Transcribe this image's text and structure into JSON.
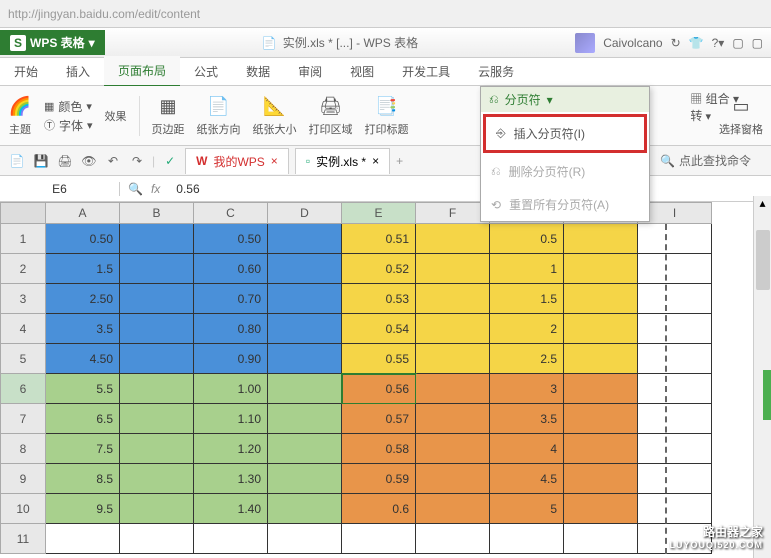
{
  "browser": {
    "url": "http://jingyan.baidu.com/edit/content"
  },
  "app": {
    "name": "WPS 表格",
    "doc_title": "实例.xls * [...] - WPS 表格",
    "user": "Caivolcano"
  },
  "menus": [
    "开始",
    "插入",
    "页面布局",
    "公式",
    "数据",
    "审阅",
    "视图",
    "开发工具",
    "云服务"
  ],
  "active_menu": 2,
  "ribbon": {
    "theme": "主题",
    "font": "字体",
    "effect": "效果",
    "color_label": "颜色",
    "margins": "页边距",
    "orientation": "纸张方向",
    "size": "纸张大小",
    "print_area": "打印区域",
    "print_title": "打印标题",
    "breaks": "分页符",
    "group": "组合",
    "rotate": "转",
    "pane": "选择窗格"
  },
  "dropdown": {
    "header": "分页符",
    "insert": "插入分页符(I)",
    "delete": "删除分页符(R)",
    "reset": "重置所有分页符(A)"
  },
  "quickbar": {
    "my_wps": "我的WPS",
    "doc_tab": "实例.xls *",
    "search": "点此查找命令"
  },
  "cell_ref": "E6",
  "formula_value": "0.56",
  "columns": [
    "A",
    "B",
    "C",
    "D",
    "E",
    "F",
    "G",
    "H",
    "I"
  ],
  "rows": [
    "1",
    "2",
    "3",
    "4",
    "5",
    "6",
    "7",
    "8",
    "9",
    "10",
    "11"
  ],
  "chart_data": {
    "type": "table",
    "columns": [
      "A",
      "B",
      "C",
      "D",
      "E",
      "F",
      "G",
      "H"
    ],
    "data": [
      {
        "A": "0.50",
        "B": "",
        "C": "0.50",
        "D": "",
        "E": "0.51",
        "F": "",
        "G": "0.5",
        "H": ""
      },
      {
        "A": "1.5",
        "B": "",
        "C": "0.60",
        "D": "",
        "E": "0.52",
        "F": "",
        "G": "1",
        "H": ""
      },
      {
        "A": "2.50",
        "B": "",
        "C": "0.70",
        "D": "",
        "E": "0.53",
        "F": "",
        "G": "1.5",
        "H": ""
      },
      {
        "A": "3.5",
        "B": "",
        "C": "0.80",
        "D": "",
        "E": "0.54",
        "F": "",
        "G": "2",
        "H": ""
      },
      {
        "A": "4.50",
        "B": "",
        "C": "0.90",
        "D": "",
        "E": "0.55",
        "F": "",
        "G": "2.5",
        "H": ""
      },
      {
        "A": "5.5",
        "B": "",
        "C": "1.00",
        "D": "",
        "E": "0.56",
        "F": "",
        "G": "3",
        "H": ""
      },
      {
        "A": "6.5",
        "B": "",
        "C": "1.10",
        "D": "",
        "E": "0.57",
        "F": "",
        "G": "3.5",
        "H": ""
      },
      {
        "A": "7.5",
        "B": "",
        "C": "1.20",
        "D": "",
        "E": "0.58",
        "F": "",
        "G": "4",
        "H": ""
      },
      {
        "A": "8.5",
        "B": "",
        "C": "1.30",
        "D": "",
        "E": "0.59",
        "F": "",
        "G": "4.5",
        "H": ""
      },
      {
        "A": "9.5",
        "B": "",
        "C": "1.40",
        "D": "",
        "E": "0.6",
        "F": "",
        "G": "5",
        "H": ""
      }
    ],
    "cell_colors": {
      "rows1_5": {
        "A-D": "blue",
        "E-H": "yellow"
      },
      "rows6_10": {
        "A-D": "green",
        "E-H": "orange"
      }
    }
  },
  "watermark": {
    "line1": "路由器之家",
    "line2": "LUYOUQI520.COM"
  }
}
